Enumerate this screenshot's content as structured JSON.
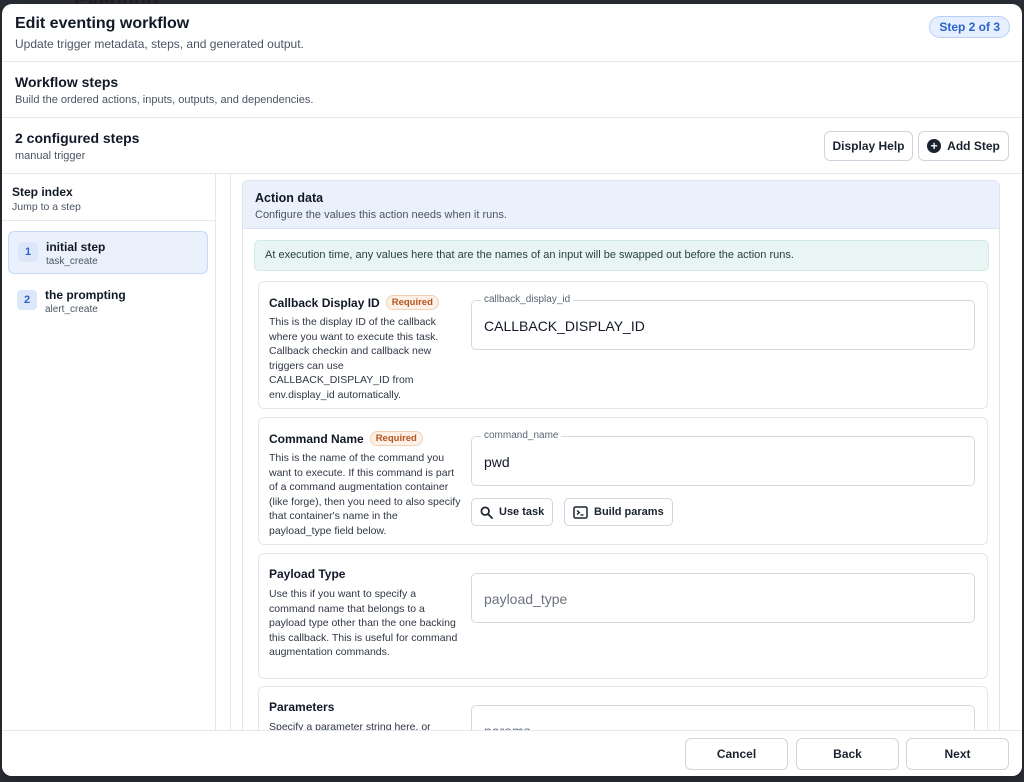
{
  "backdrop": {
    "title": "Eventing"
  },
  "dialog": {
    "title": "Edit eventing workflow",
    "subtitle": "Update trigger metadata, steps, and generated output.",
    "step_badge": "Step 2 of 3"
  },
  "workflow_steps": {
    "title": "Workflow steps",
    "subtitle": "Build the ordered actions, inputs, outputs, and dependencies."
  },
  "configured": {
    "title": "2 configured steps",
    "subtitle": "manual trigger",
    "display_help_label": "Display Help",
    "add_step_label": "Add Step"
  },
  "sidebar": {
    "title": "Step index",
    "subtitle": "Jump to a step",
    "items": [
      {
        "num": "1",
        "name": "initial step",
        "kind": "task_create",
        "active": true
      },
      {
        "num": "2",
        "name": "the prompting",
        "kind": "alert_create",
        "active": false
      }
    ]
  },
  "action": {
    "title": "Action data",
    "subtitle": "Configure the values this action needs when it runs.",
    "notice": "At execution time, any values here that are the names of an input will be swapped out before the action runs."
  },
  "fields": {
    "callback": {
      "label": "Callback Display ID",
      "required_label": "Required",
      "description": "This is the display ID of the callback where you want to execute this task. Callback checkin and callback new triggers can use CALLBACK_DISPLAY_ID from env.display_id automatically.",
      "legend": "callback_display_id",
      "value": "CALLBACK_DISPLAY_ID"
    },
    "command": {
      "label": "Command Name",
      "required_label": "Required",
      "description": "This is the name of the command you want to execute. If this command is part of a command augmentation container (like forge), then you need to also specify that container's name in the payload_type field below.",
      "legend": "command_name",
      "value": "pwd",
      "use_task_label": "Use task",
      "build_params_label": "Build params"
    },
    "payload": {
      "label": "Payload Type",
      "description": "Use this if you want to specify a command name that belongs to a payload type other than the one backing this callback. This is useful for command augmentation commands.",
      "placeholder": "payload_type"
    },
    "parameters": {
      "label": "Parameters",
      "description": "Specify a parameter string here, or",
      "placeholder": "params"
    }
  },
  "footer": {
    "cancel_label": "Cancel",
    "back_label": "Back",
    "next_label": "Next"
  }
}
